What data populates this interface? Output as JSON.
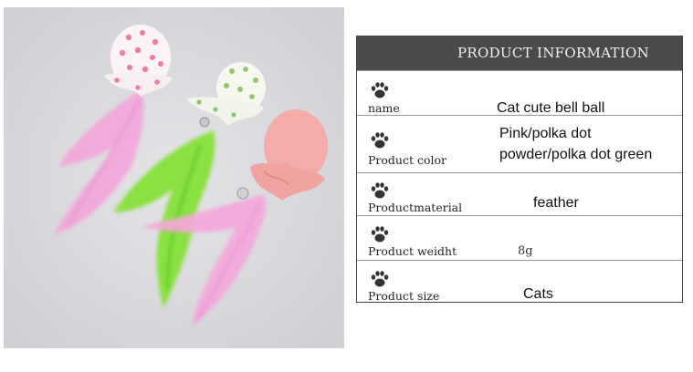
{
  "table": {
    "title": "PRODUCT INFORMATION",
    "rows": [
      {
        "label": "name",
        "value_lines": [
          "Cat cute bell ball"
        ]
      },
      {
        "label": "Product color",
        "value_lines": [
          "Pink/polka dot",
          "powder/polka dot green"
        ]
      },
      {
        "label": "Productmaterial",
        "value_lines": [
          "feather"
        ]
      },
      {
        "label": "Product weidht",
        "value_lines": [
          "8g"
        ]
      },
      {
        "label": "Product size",
        "value_lines": [
          "Cats"
        ]
      }
    ]
  },
  "icons": {
    "row_icon": "paw-print-icon"
  },
  "colors": {
    "header_bg": "#4a4a4a",
    "pink_feather": "#f3a6d6",
    "green_feather": "#7fe03a",
    "salmon_ball": "#f2a9a6"
  }
}
